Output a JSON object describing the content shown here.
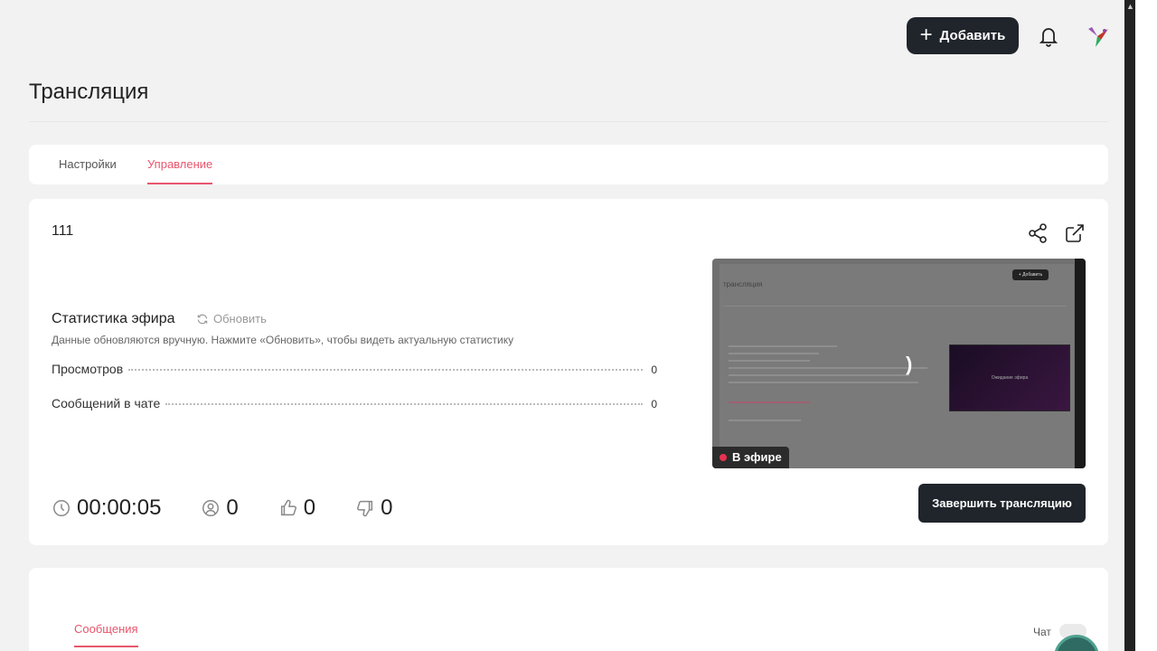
{
  "header": {
    "add_label": "Добавить"
  },
  "page": {
    "title": "Трансляция"
  },
  "tabs": [
    {
      "label": "Настройки"
    },
    {
      "label": "Управление"
    }
  ],
  "stream": {
    "name": "111",
    "stats_title": "Статистика эфира",
    "refresh_label": "Обновить",
    "stats_hint": "Данные обновляются вручную. Нажмите «Обновить», чтобы видеть актуальную статистику",
    "rows": [
      {
        "label": "Просмотров",
        "value": "0"
      },
      {
        "label": "Сообщений в чате",
        "value": "0"
      }
    ],
    "live_label": "В эфире",
    "timer": "00:00:05",
    "viewers": "0",
    "likes": "0",
    "dislikes": "0",
    "end_label": "Завершить трансляцию"
  },
  "preview": {
    "mini_title": "трансляция",
    "mini_add": "+ Добавить",
    "mini_video_text": "Ожидание эфира"
  },
  "chat": {
    "tab_label": "Сообщения",
    "chat_label": "Чат"
  },
  "colors": {
    "accent": "#e8566d",
    "dark": "#20242b",
    "live": "#e8324f"
  }
}
